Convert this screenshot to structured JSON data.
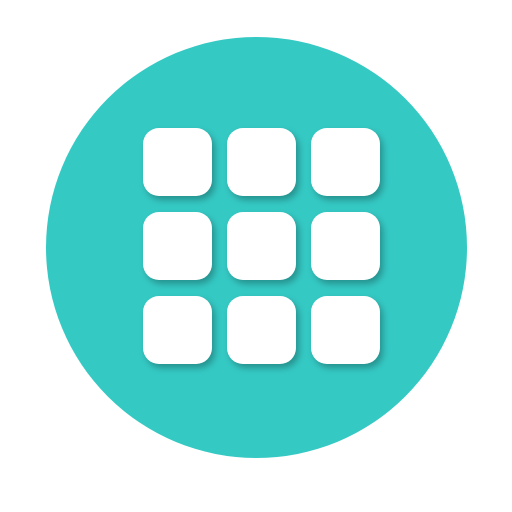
{
  "icon": {
    "name": "app-grid-icon",
    "background_color": "#35c9c4",
    "tile_color": "#ffffff",
    "rows": 3,
    "columns": 3
  }
}
